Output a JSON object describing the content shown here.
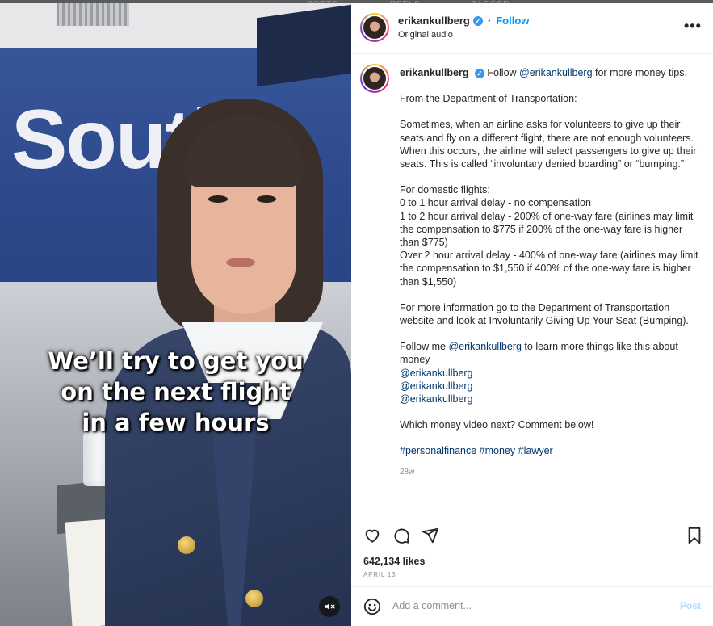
{
  "backdrop": {
    "tab_posts": "POSTS",
    "tab_reels": "REELS",
    "tab_tagged": "TAGGED"
  },
  "video": {
    "sign_text": "South",
    "caption_lines": [
      "We’ll try to get you",
      "on the next flight",
      "in a few hours"
    ],
    "mute_icon": "speaker-muted-icon"
  },
  "header": {
    "username": "erikankullberg",
    "follow_label": "Follow",
    "audio_label": "Original audio",
    "more_label": "•••"
  },
  "post": {
    "username": "erikankullberg",
    "intro_text": "Follow ",
    "intro_mention": "@erikankullberg",
    "intro_tail": " for more money tips.",
    "p_source": "From the Department of Transportation:",
    "p_body": "Sometimes, when an airline asks for volunteers to give up their seats and fly on a different flight, there are not enough volunteers.  When this occurs, the airline will select passengers to give up their seats.  This is called “involuntary denied boarding” or “bumping.”",
    "p_domestic": "For domestic flights:\n0 to 1 hour arrival delay - no compensation\n1 to 2 hour arrival delay - 200% of one-way fare (airlines may limit the compensation to $775 if 200% of the one-way fare is higher than $775)\nOver 2 hour arrival delay - 400% of one-way fare (airlines may limit the compensation to $1,550 if 400% of the one-way fare is higher than $1,550)",
    "p_more_info": "For more information go to the Department of Transportation website and look at Involuntarily Giving Up Your Seat (Bumping).",
    "follow_me_text": "Follow me ",
    "follow_me_mention": "@erikankullberg",
    "follow_me_tail": " to learn more things like this about money",
    "mentions": [
      "@erikankullberg",
      "@erikankullberg",
      "@erikankullberg"
    ],
    "question": "Which money video next? Comment below!",
    "hashtags": "#personalfinance #money #lawyer",
    "time_ago": "28w"
  },
  "actions": {
    "likes": "642,134 likes",
    "date": "APRIL 13"
  },
  "comment": {
    "placeholder": "Add a comment...",
    "post_label": "Post"
  },
  "colors": {
    "link_blue": "#0095f6",
    "mention_navy": "#00376b",
    "verified_blue": "#3897f0",
    "post_disabled": "#b3dbff"
  }
}
